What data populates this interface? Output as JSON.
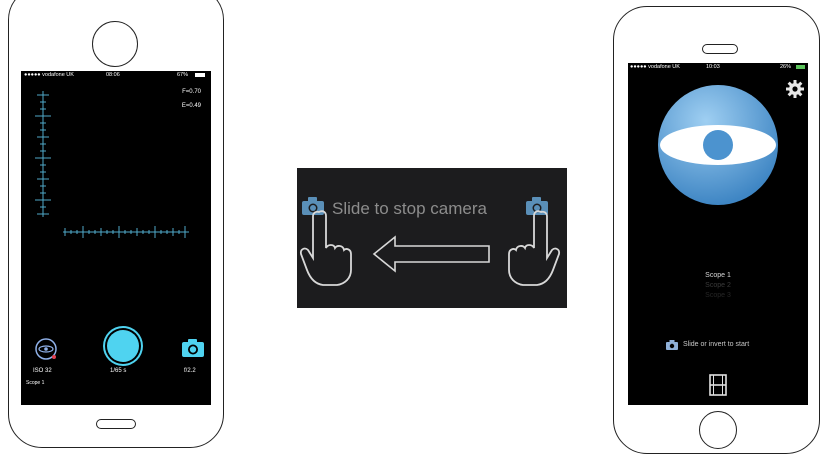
{
  "colors": {
    "accent": "#4fd3f0",
    "bubble": "#6aaedf",
    "screen": "#000000",
    "banner": "#1c1c1e"
  },
  "left_phone": {
    "status": {
      "carrier": "●●●●● vodafone UK",
      "time": "08:06",
      "battery": "67%"
    },
    "readouts": {
      "f": "F=0.70",
      "e": "E=0.49"
    },
    "controls": {
      "iso": "ISO 32",
      "shutter": "1/65 s",
      "aperture": "f/2.2"
    },
    "scope": "Scope 1",
    "icons": {
      "eye": "eye-circle-icon",
      "shutter": "shutter-button",
      "camera": "camera-icon"
    }
  },
  "banner": {
    "label": "Slide to stop camera",
    "icons": [
      "camera-icon",
      "hand-pointer-icon",
      "arrow-left-icon",
      "camera-icon",
      "hand-pointer-icon"
    ]
  },
  "right_phone": {
    "status": {
      "carrier": "●●●●● vodafone UK",
      "time": "10:03",
      "battery": "26%"
    },
    "scopes": [
      "Scope 1",
      "Scope 2",
      "Scope 3"
    ],
    "hint": "Slide or invert to start",
    "icons": {
      "settings": "gear-icon",
      "logo": "eye-logo-icon",
      "film": "film-icon",
      "camera": "camera-icon"
    }
  }
}
